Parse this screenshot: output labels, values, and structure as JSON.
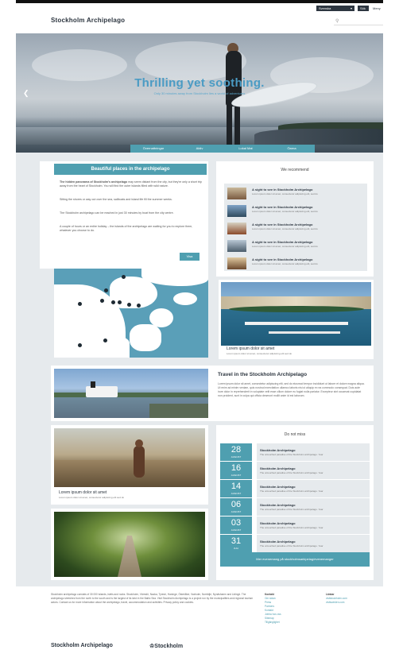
{
  "header": {
    "logo": "Stockholm Archipelago",
    "language": "Svenska",
    "button_primary": "Sök",
    "button_secondary": "Meny",
    "search_placeholder": "Sök"
  },
  "hero": {
    "title": "Thrilling yet soothing.",
    "subtitle": "Only 30 minutes away from Stockholm lies a world of adventures"
  },
  "nav": {
    "items": [
      {
        "label": "Övernattningar"
      },
      {
        "label": "Aktiv"
      },
      {
        "label": "Lokal Mat"
      },
      {
        "label": "Öarna"
      }
    ]
  },
  "intro": {
    "heading": "Beautiful places in the archipelago",
    "p1_bold": "The hidden panorama of Stockholm's archipelago",
    "p1": "may seem distant from the city, but they're only a short trip away from the heart of Stockholm. You will find the outer islands filled with wild nature.",
    "p2": "Sitting the shores or way out over the sea, sailboats and island life fill the summer weeks.",
    "p3": "The Stockholm archipelago can be reached in just 30 minutes by boat from the city centre.",
    "p4": "A couple of hours or an entire holiday – the islands of the archipelago are waiting for you to explore them, whatever you choose to do.",
    "more_button": "Visa"
  },
  "recommend": {
    "heading": "We recommend",
    "items": [
      {
        "title": "A sight to see in Stockholm Archipelago",
        "text": "Lorem ipsum dolor sit amet, consectetur adipiscing elit, sed do"
      },
      {
        "title": "A sight to see in Stockholm Archipelago",
        "text": "Lorem ipsum dolor sit amet, consectetur adipiscing elit, sed do"
      },
      {
        "title": "A sight to see in Stockholm Archipelago",
        "text": "Lorem ipsum dolor sit amet, consectetur adipiscing elit, sed do"
      },
      {
        "title": "A sight to see in Stockholm Archipelago",
        "text": "Lorem ipsum dolor sit amet, consectetur adipiscing elit, sed do"
      },
      {
        "title": "A sight to see in Stockholm Archipelago",
        "text": "Lorem ipsum dolor sit amet, consectetur adipiscing elit, sed do"
      }
    ]
  },
  "harbor": {
    "caption": "Lorem ipsum dolor sit amet",
    "subcaption": "Lorem ipsum dolor sit amet, consectetur adipiscing elit sed do"
  },
  "travel": {
    "heading": "Travel in the Stockholm Archipelago",
    "text": "Lorem ipsum dolor sit amet, consectetur adipiscing elit, sed do eiusmod tempor incididunt ut labore et dolore magna aliqua. Ut enim ad minim veniam, quis nostrud exercitation ullamco laboris nisi ut aliquip ex ea commodo consequat. Duis aute irure dolor in reprehenderit in voluptate velit esse cillum dolore eu fugiat nulla pariatur. Excepteur sint occaecat cupidatat non proident, sunt in culpa qui officia deserunt mollit anim id est laborum."
  },
  "boy": {
    "caption": "Lorem ipsum dolor sit amet",
    "subcaption": "Lorem ipsum dolor sit amet, consectetur adipiscing elit sed do"
  },
  "missed": {
    "heading": "Do not miss",
    "events": [
      {
        "day": "28",
        "month": "AUGUST",
        "title": "Stockholm Archipelago",
        "text": "The untouched paradise of the Stockholm archipelago. Year"
      },
      {
        "day": "16",
        "month": "AUGUST",
        "title": "Stockholm Archipelago",
        "text": "The untouched paradise of the Stockholm archipelago. Year"
      },
      {
        "day": "14",
        "month": "AUGUST",
        "title": "Stockholm Archipelago",
        "text": "The untouched paradise of the Stockholm archipelago. Year"
      },
      {
        "day": "06",
        "month": "AUGUST",
        "title": "Stockholm Archipelago",
        "text": "The untouched paradise of the Stockholm archipelago. Year"
      },
      {
        "day": "03",
        "month": "AUGUST",
        "title": "Stockholm Archipelago",
        "text": "The untouched paradise of the Stockholm archipelago. Year"
      },
      {
        "day": "31",
        "month": "JULI",
        "title": "Stockholm Archipelago",
        "text": "The untouched paradise of the Stockholm archipelago. Year"
      }
    ],
    "all_button": "Mer evenemang på stockholmsarkipelag/evenemanger"
  },
  "footer": {
    "text": "Stockholm archipelago consists of 30 000 islands, islets and rocks. Stockholm, Värmdö, Nacka, Tyresö, Haninge, Österåker, Vaxholm, Norrtälje, Nynäshamn and Lidingö. The archipelago stretches from the north to the south and is the largest of its kind in the Baltic Sea. Visit Stockholm Archipelago is a project run by the municipalities and regional tourism actors. Contact us for more information about the archipelago, travel, accommodation and activities. Privacy policy and cookies.",
    "col1_heading": "Kontakt",
    "col1_links": [
      "Om sidan",
      "Press",
      "Partners",
      "Kontakt",
      "Jobba hos oss",
      "Sitemap",
      "Tillgänglighet"
    ],
    "col2_heading": "Länkar",
    "col2_links": [
      "visitstockholm.com",
      "visitsweden.com"
    ],
    "logo_left": "Stockholm Archipelago",
    "logo_right": "Stockholm"
  }
}
